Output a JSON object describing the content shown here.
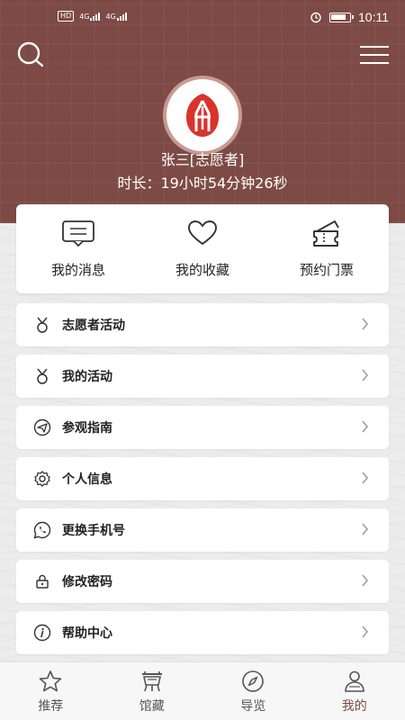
{
  "status_bar": {
    "left_badges": [
      "HD",
      "4G",
      "4G"
    ],
    "time": "10:11",
    "icons": [
      "alarm-icon",
      "battery-icon"
    ]
  },
  "header": {
    "search_icon": "search-icon",
    "menu_icon": "hamburger-menu-icon",
    "colors": {
      "header_bg": "#7d4a45",
      "accent": "#d9332c"
    }
  },
  "profile": {
    "name": "张三[志愿者]",
    "duration": "时长：19小时54分钟26秒",
    "avatar_icon": "museum-logo-icon"
  },
  "quick_actions": [
    {
      "label": "我的消息",
      "icon": "message-icon"
    },
    {
      "label": "我的收藏",
      "icon": "heart-icon"
    },
    {
      "label": "预约门票",
      "icon": "ticket-icon"
    }
  ],
  "menu_items": [
    {
      "label": "志愿者活动",
      "icon": "medal-icon"
    },
    {
      "label": "我的活动",
      "icon": "medal-icon"
    },
    {
      "label": "参观指南",
      "icon": "send-icon"
    },
    {
      "label": "个人信息",
      "icon": "gear-icon"
    },
    {
      "label": "更换手机号",
      "icon": "phone-icon"
    },
    {
      "label": "修改密码",
      "icon": "lock-icon"
    },
    {
      "label": "帮助中心",
      "icon": "info-icon"
    }
  ],
  "bottom_nav": [
    {
      "label": "推荐",
      "icon": "star-icon",
      "active": false
    },
    {
      "label": "馆藏",
      "icon": "bronze-vessel-icon",
      "active": false
    },
    {
      "label": "导览",
      "icon": "compass-icon",
      "active": false
    },
    {
      "label": "我的",
      "icon": "person-icon",
      "active": true
    }
  ]
}
